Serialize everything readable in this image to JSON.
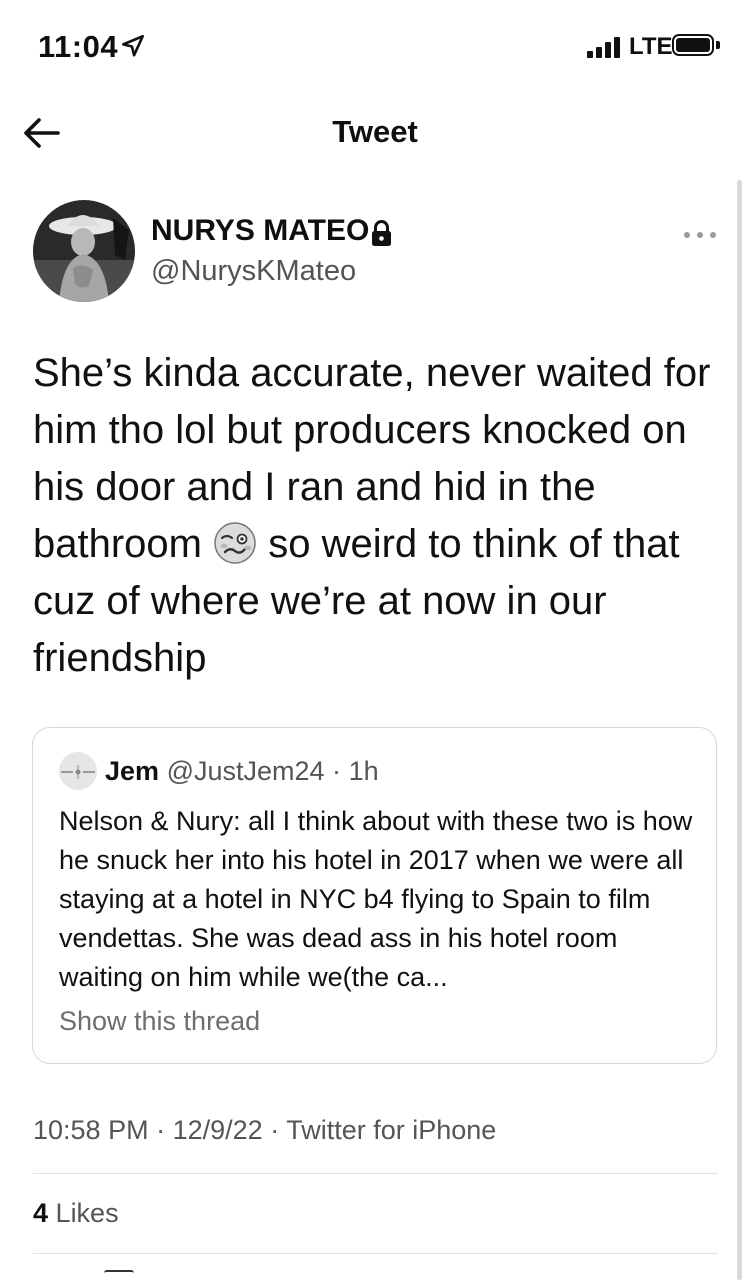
{
  "status_bar": {
    "time": "11:04",
    "network": "LTE",
    "icons": [
      "location-arrow-icon",
      "signal-bars-icon",
      "battery-icon"
    ]
  },
  "nav": {
    "title": "Tweet",
    "back_icon": "arrow-left-icon"
  },
  "tweet": {
    "author_name": "NURYS MATEO",
    "author_handle": "@NurysKMateo",
    "protected_icon": "lock-icon",
    "text_parts": [
      "She’s kinda accurate, never waited for him tho lol but producers knocked on his door and I ran and hid in the bathroom",
      "so weird to think of that cuz of where we’re at now in our friendship"
    ],
    "emoji": "woozy-face-emoji",
    "timestamp": "10:58 PM",
    "date": "12/9/22",
    "source": "Twitter for iPhone",
    "sep": "·",
    "likes_count": "4",
    "likes_label": "Likes"
  },
  "quoted_tweet": {
    "author_name": "Jem",
    "author_handle": "@JustJem24",
    "dot": "·",
    "time": "1h",
    "text": "Nelson & Nury:  all I think about with these two is how he snuck her into his hotel in 2017 when we were all staying at a hotel in NYC b4 flying to Spain to film vendettas. She was dead ass in his hotel room waiting on him while we(the ca...",
    "show_thread": "Show this thread"
  }
}
